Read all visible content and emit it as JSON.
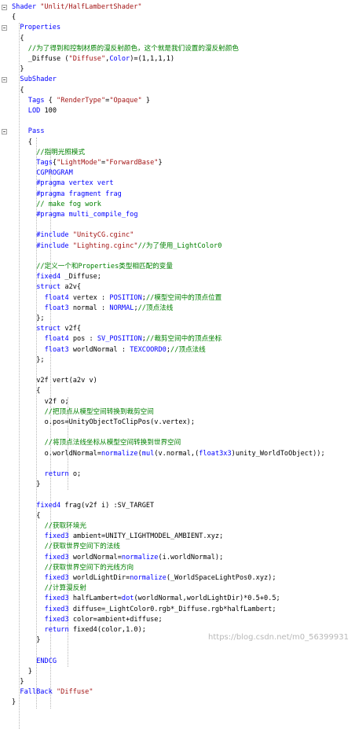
{
  "editor": {
    "lines": [
      {
        "indent": 0,
        "tokens": [
          {
            "t": "Shader ",
            "c": "keyword"
          },
          {
            "t": "\"Unlit/HalfLambertShader\"",
            "c": "string"
          }
        ]
      },
      {
        "indent": 0,
        "tokens": [
          {
            "t": "{",
            "c": "plain"
          }
        ]
      },
      {
        "indent": 2,
        "tokens": [
          {
            "t": "Properties",
            "c": "keyword"
          }
        ]
      },
      {
        "indent": 2,
        "tokens": [
          {
            "t": "{",
            "c": "plain"
          }
        ]
      },
      {
        "indent": 4,
        "tokens": [
          {
            "t": "//为了得到和控制材质的漫反射颜色，这个就是我们设置的漫反射颜色",
            "c": "comment"
          }
        ]
      },
      {
        "indent": 4,
        "tokens": [
          {
            "t": "_Diffuse (",
            "c": "plain"
          },
          {
            "t": "\"Diffuse\"",
            "c": "string"
          },
          {
            "t": ",",
            "c": "plain"
          },
          {
            "t": "Color",
            "c": "keyword"
          },
          {
            "t": ")=(1,1,1,1)",
            "c": "plain"
          }
        ]
      },
      {
        "indent": 2,
        "tokens": [
          {
            "t": "}",
            "c": "plain"
          }
        ]
      },
      {
        "indent": 2,
        "tokens": [
          {
            "t": "SubShader",
            "c": "keyword"
          }
        ]
      },
      {
        "indent": 2,
        "tokens": [
          {
            "t": "{",
            "c": "plain"
          }
        ]
      },
      {
        "indent": 4,
        "tokens": [
          {
            "t": "Tags",
            "c": "keyword"
          },
          {
            "t": " { ",
            "c": "plain"
          },
          {
            "t": "\"RenderType\"",
            "c": "string"
          },
          {
            "t": "=",
            "c": "plain"
          },
          {
            "t": "\"Opaque\"",
            "c": "string"
          },
          {
            "t": " }",
            "c": "plain"
          }
        ]
      },
      {
        "indent": 4,
        "tokens": [
          {
            "t": "LOD",
            "c": "keyword"
          },
          {
            "t": " 100",
            "c": "plain"
          }
        ]
      },
      {
        "indent": 0,
        "tokens": []
      },
      {
        "indent": 4,
        "tokens": [
          {
            "t": "Pass",
            "c": "keyword"
          }
        ]
      },
      {
        "indent": 4,
        "tokens": [
          {
            "t": "{",
            "c": "plain"
          }
        ]
      },
      {
        "indent": 6,
        "tokens": [
          {
            "t": "//指明光照模式",
            "c": "comment"
          }
        ]
      },
      {
        "indent": 6,
        "tokens": [
          {
            "t": "Tags",
            "c": "keyword"
          },
          {
            "t": "{",
            "c": "plain"
          },
          {
            "t": "\"LightMode\"",
            "c": "string"
          },
          {
            "t": "=",
            "c": "plain"
          },
          {
            "t": "\"ForwardBase\"",
            "c": "string"
          },
          {
            "t": "}",
            "c": "plain"
          }
        ]
      },
      {
        "indent": 6,
        "tokens": [
          {
            "t": "CGPROGRAM",
            "c": "keyword"
          }
        ]
      },
      {
        "indent": 6,
        "tokens": [
          {
            "t": "#pragma vertex vert",
            "c": "directive"
          }
        ]
      },
      {
        "indent": 6,
        "tokens": [
          {
            "t": "#pragma fragment frag",
            "c": "directive"
          }
        ]
      },
      {
        "indent": 6,
        "tokens": [
          {
            "t": "// make fog work",
            "c": "comment"
          }
        ]
      },
      {
        "indent": 6,
        "tokens": [
          {
            "t": "#pragma multi_compile_fog",
            "c": "directive"
          }
        ]
      },
      {
        "indent": 0,
        "tokens": []
      },
      {
        "indent": 6,
        "tokens": [
          {
            "t": "#include ",
            "c": "directive"
          },
          {
            "t": "\"UnityCG.cginc\"",
            "c": "string"
          }
        ]
      },
      {
        "indent": 6,
        "tokens": [
          {
            "t": "#include ",
            "c": "directive"
          },
          {
            "t": "\"Lighting.cginc\"",
            "c": "string"
          },
          {
            "t": "//为了使用_LightColor0",
            "c": "comment"
          }
        ]
      },
      {
        "indent": 0,
        "tokens": []
      },
      {
        "indent": 6,
        "tokens": [
          {
            "t": "//定义一个和Properties类型相匹配的变量",
            "c": "comment"
          }
        ]
      },
      {
        "indent": 6,
        "tokens": [
          {
            "t": "fixed4",
            "c": "type"
          },
          {
            "t": " _Diffuse;",
            "c": "plain"
          }
        ]
      },
      {
        "indent": 6,
        "tokens": [
          {
            "t": "struct",
            "c": "keyword"
          },
          {
            "t": " a2v{",
            "c": "plain"
          }
        ]
      },
      {
        "indent": 8,
        "tokens": [
          {
            "t": "float4",
            "c": "type"
          },
          {
            "t": " vertex : ",
            "c": "plain"
          },
          {
            "t": "POSITION",
            "c": "semantic"
          },
          {
            "t": ";",
            "c": "plain"
          },
          {
            "t": "//模型空间中的顶点位置",
            "c": "comment"
          }
        ]
      },
      {
        "indent": 8,
        "tokens": [
          {
            "t": "float3",
            "c": "type"
          },
          {
            "t": " normal : ",
            "c": "plain"
          },
          {
            "t": "NORMAL",
            "c": "semantic"
          },
          {
            "t": ";",
            "c": "plain"
          },
          {
            "t": "//顶点法线",
            "c": "comment"
          }
        ]
      },
      {
        "indent": 6,
        "tokens": [
          {
            "t": "};",
            "c": "plain"
          }
        ]
      },
      {
        "indent": 6,
        "tokens": [
          {
            "t": "struct",
            "c": "keyword"
          },
          {
            "t": " v2f{",
            "c": "plain"
          }
        ]
      },
      {
        "indent": 8,
        "tokens": [
          {
            "t": "float4",
            "c": "type"
          },
          {
            "t": " pos : ",
            "c": "plain"
          },
          {
            "t": "SV_POSITION",
            "c": "semantic"
          },
          {
            "t": ";",
            "c": "plain"
          },
          {
            "t": "//裁剪空间中的顶点坐标",
            "c": "comment"
          }
        ]
      },
      {
        "indent": 8,
        "tokens": [
          {
            "t": "float3",
            "c": "type"
          },
          {
            "t": " worldNormal : ",
            "c": "plain"
          },
          {
            "t": "TEXCOORD0",
            "c": "semantic"
          },
          {
            "t": ";",
            "c": "plain"
          },
          {
            "t": "//顶点法线",
            "c": "comment"
          }
        ]
      },
      {
        "indent": 6,
        "tokens": [
          {
            "t": "};",
            "c": "plain"
          }
        ]
      },
      {
        "indent": 0,
        "tokens": []
      },
      {
        "indent": 6,
        "tokens": [
          {
            "t": "v2f vert(a2v v)",
            "c": "plain"
          }
        ]
      },
      {
        "indent": 6,
        "tokens": [
          {
            "t": "{",
            "c": "plain"
          }
        ]
      },
      {
        "indent": 8,
        "tokens": [
          {
            "t": "v2f o;",
            "c": "plain"
          }
        ]
      },
      {
        "indent": 8,
        "tokens": [
          {
            "t": "//把顶点从模型空间转换到裁剪空间",
            "c": "comment"
          }
        ]
      },
      {
        "indent": 8,
        "tokens": [
          {
            "t": "o.pos=UnityObjectToClipPos(v.vertex);",
            "c": "plain"
          }
        ]
      },
      {
        "indent": 0,
        "tokens": []
      },
      {
        "indent": 8,
        "tokens": [
          {
            "t": "//将顶点法线坐标从模型空间转换到世界空间",
            "c": "comment"
          }
        ]
      },
      {
        "indent": 8,
        "tokens": [
          {
            "t": "o.worldNormal=",
            "c": "plain"
          },
          {
            "t": "normalize",
            "c": "func"
          },
          {
            "t": "(",
            "c": "plain"
          },
          {
            "t": "mul",
            "c": "func"
          },
          {
            "t": "(v.normal,(",
            "c": "plain"
          },
          {
            "t": "float3x3",
            "c": "type"
          },
          {
            "t": ")unity_WorldToObject));",
            "c": "plain"
          }
        ]
      },
      {
        "indent": 0,
        "tokens": []
      },
      {
        "indent": 8,
        "tokens": [
          {
            "t": "return",
            "c": "keyword"
          },
          {
            "t": " o;",
            "c": "plain"
          }
        ]
      },
      {
        "indent": 6,
        "tokens": [
          {
            "t": "}",
            "c": "plain"
          }
        ]
      },
      {
        "indent": 0,
        "tokens": []
      },
      {
        "indent": 6,
        "tokens": [
          {
            "t": "fixed4",
            "c": "type"
          },
          {
            "t": " frag(v2f i) :SV_TARGET",
            "c": "plain"
          }
        ]
      },
      {
        "indent": 6,
        "tokens": [
          {
            "t": "{",
            "c": "plain"
          }
        ]
      },
      {
        "indent": 8,
        "tokens": [
          {
            "t": "//获取环境光",
            "c": "comment"
          }
        ]
      },
      {
        "indent": 8,
        "tokens": [
          {
            "t": "fixed3",
            "c": "type"
          },
          {
            "t": " ambient=UNITY_LIGHTMODEL_AMBIENT.xyz;",
            "c": "plain"
          }
        ]
      },
      {
        "indent": 8,
        "tokens": [
          {
            "t": "//获取世界空间下的法线",
            "c": "comment"
          }
        ]
      },
      {
        "indent": 8,
        "tokens": [
          {
            "t": "fixed3",
            "c": "type"
          },
          {
            "t": " worldNormal=",
            "c": "plain"
          },
          {
            "t": "normalize",
            "c": "func"
          },
          {
            "t": "(i.worldNormal);",
            "c": "plain"
          }
        ]
      },
      {
        "indent": 8,
        "tokens": [
          {
            "t": "//获取世界空间下的光线方向",
            "c": "comment"
          }
        ]
      },
      {
        "indent": 8,
        "tokens": [
          {
            "t": "fixed3",
            "c": "type"
          },
          {
            "t": " worldLightDir=",
            "c": "plain"
          },
          {
            "t": "normalize",
            "c": "func"
          },
          {
            "t": "(_WorldSpaceLightPos0.xyz);",
            "c": "plain"
          }
        ]
      },
      {
        "indent": 8,
        "tokens": [
          {
            "t": "//计算漫反射",
            "c": "comment"
          }
        ]
      },
      {
        "indent": 8,
        "tokens": [
          {
            "t": "fixed3",
            "c": "type"
          },
          {
            "t": " halfLambert=",
            "c": "plain"
          },
          {
            "t": "dot",
            "c": "func"
          },
          {
            "t": "(worldNormal,worldLightDir)*0.5+0.5;",
            "c": "plain"
          }
        ]
      },
      {
        "indent": 8,
        "tokens": [
          {
            "t": "fixed3",
            "c": "type"
          },
          {
            "t": " diffuse=_LightColor0.rgb*_Diffuse.rgb*halfLambert;",
            "c": "plain"
          }
        ]
      },
      {
        "indent": 8,
        "tokens": [
          {
            "t": "fixed3",
            "c": "type"
          },
          {
            "t": " color=ambient+diffuse;",
            "c": "plain"
          }
        ]
      },
      {
        "indent": 8,
        "tokens": [
          {
            "t": "return",
            "c": "keyword"
          },
          {
            "t": " fixed4(color,1.0);",
            "c": "plain"
          }
        ]
      },
      {
        "indent": 6,
        "tokens": [
          {
            "t": "}",
            "c": "plain"
          }
        ]
      },
      {
        "indent": 0,
        "tokens": []
      },
      {
        "indent": 6,
        "tokens": [
          {
            "t": "ENDCG",
            "c": "keyword"
          }
        ]
      },
      {
        "indent": 4,
        "tokens": [
          {
            "t": "}",
            "c": "plain"
          }
        ]
      },
      {
        "indent": 2,
        "tokens": [
          {
            "t": "}",
            "c": "plain"
          }
        ]
      },
      {
        "indent": 2,
        "tokens": [
          {
            "t": "FallBack ",
            "c": "keyword"
          },
          {
            "t": "\"Diffuse\"",
            "c": "string"
          }
        ]
      },
      {
        "indent": 0,
        "tokens": [
          {
            "t": "}",
            "c": "plain"
          }
        ]
      }
    ]
  },
  "watermark": "https://blog.csdn.net/m0_56399931",
  "colors": {
    "keyword": "#0000ff",
    "comment": "#008000",
    "string": "#a31515",
    "plain": "#000000",
    "background": "#ffffff"
  }
}
